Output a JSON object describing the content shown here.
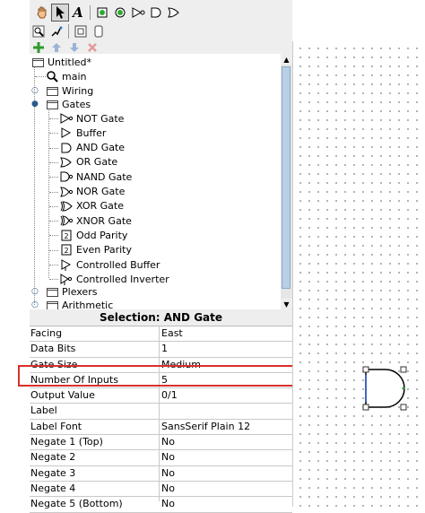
{
  "toolbar": {
    "tools": [
      {
        "name": "poke-tool",
        "icon": "hand-icon"
      },
      {
        "name": "select-tool",
        "icon": "arrow-pointer-icon",
        "selected": true
      },
      {
        "name": "text-tool",
        "icon": "text-A-icon",
        "glyph": "A"
      },
      {
        "name": "input-pin-tool",
        "icon": "input-pin-icon"
      },
      {
        "name": "output-pin-tool",
        "icon": "output-pin-icon"
      },
      {
        "name": "not-gate-tool",
        "icon": "not-gate-icon"
      },
      {
        "name": "and-gate-tool",
        "icon": "and-gate-icon"
      },
      {
        "name": "or-gate-tool",
        "icon": "or-gate-icon"
      }
    ],
    "row2": [
      {
        "name": "zoom-tool",
        "icon": "magnifier-icon"
      },
      {
        "name": "wiring-tool",
        "icon": "wiring-icon"
      },
      {
        "name": "layout-view",
        "icon": "layout-icon"
      },
      {
        "name": "appearance-view",
        "icon": "appearance-icon"
      }
    ],
    "row3": [
      {
        "name": "add-circuit",
        "icon": "plus-icon",
        "color": "#2e9a2e"
      },
      {
        "name": "move-up",
        "icon": "arrow-up-icon",
        "color": "#9ab3d6"
      },
      {
        "name": "move-down",
        "icon": "arrow-down-icon",
        "color": "#9ab3d6"
      },
      {
        "name": "delete",
        "icon": "x-icon",
        "color": "#e49a9a"
      }
    ]
  },
  "tree": {
    "project": "Untitled*",
    "circuit": "main",
    "libraries": [
      "Wiring",
      "Gates",
      "Plexers",
      "Arithmetic"
    ],
    "gates": [
      {
        "label": "NOT Gate",
        "icon": "not-gate-icon"
      },
      {
        "label": "Buffer",
        "icon": "buffer-icon"
      },
      {
        "label": "AND Gate",
        "icon": "and-gate-icon"
      },
      {
        "label": "OR Gate",
        "icon": "or-gate-icon"
      },
      {
        "label": "NAND Gate",
        "icon": "nand-gate-icon"
      },
      {
        "label": "NOR Gate",
        "icon": "nor-gate-icon"
      },
      {
        "label": "XOR Gate",
        "icon": "xor-gate-icon"
      },
      {
        "label": "XNOR Gate",
        "icon": "xnor-gate-icon"
      },
      {
        "label": "Odd Parity",
        "icon": "odd-parity-icon"
      },
      {
        "label": "Even Parity",
        "icon": "even-parity-icon"
      },
      {
        "label": "Controlled Buffer",
        "icon": "controlled-buffer-icon"
      },
      {
        "label": "Controlled Inverter",
        "icon": "controlled-inverter-icon"
      }
    ]
  },
  "selection": {
    "title": "Selection: AND Gate",
    "attributes": [
      {
        "name": "Facing",
        "value": "East"
      },
      {
        "name": "Data Bits",
        "value": "1"
      },
      {
        "name": "Gate Size",
        "value": "Medium"
      },
      {
        "name": "Number Of Inputs",
        "value": "5"
      },
      {
        "name": "Output Value",
        "value": "0/1"
      },
      {
        "name": "Label",
        "value": ""
      },
      {
        "name": "Label Font",
        "value": "SansSerif Plain 12"
      },
      {
        "name": "Negate 1 (Top)",
        "value": "No"
      },
      {
        "name": "Negate 2",
        "value": "No"
      },
      {
        "name": "Negate 3",
        "value": "No"
      },
      {
        "name": "Negate 4",
        "value": "No"
      },
      {
        "name": "Negate 5 (Bottom)",
        "value": "No"
      }
    ]
  },
  "colors": {
    "highlight": "#d9302a",
    "gate": "#000000",
    "handles": "#333333"
  }
}
